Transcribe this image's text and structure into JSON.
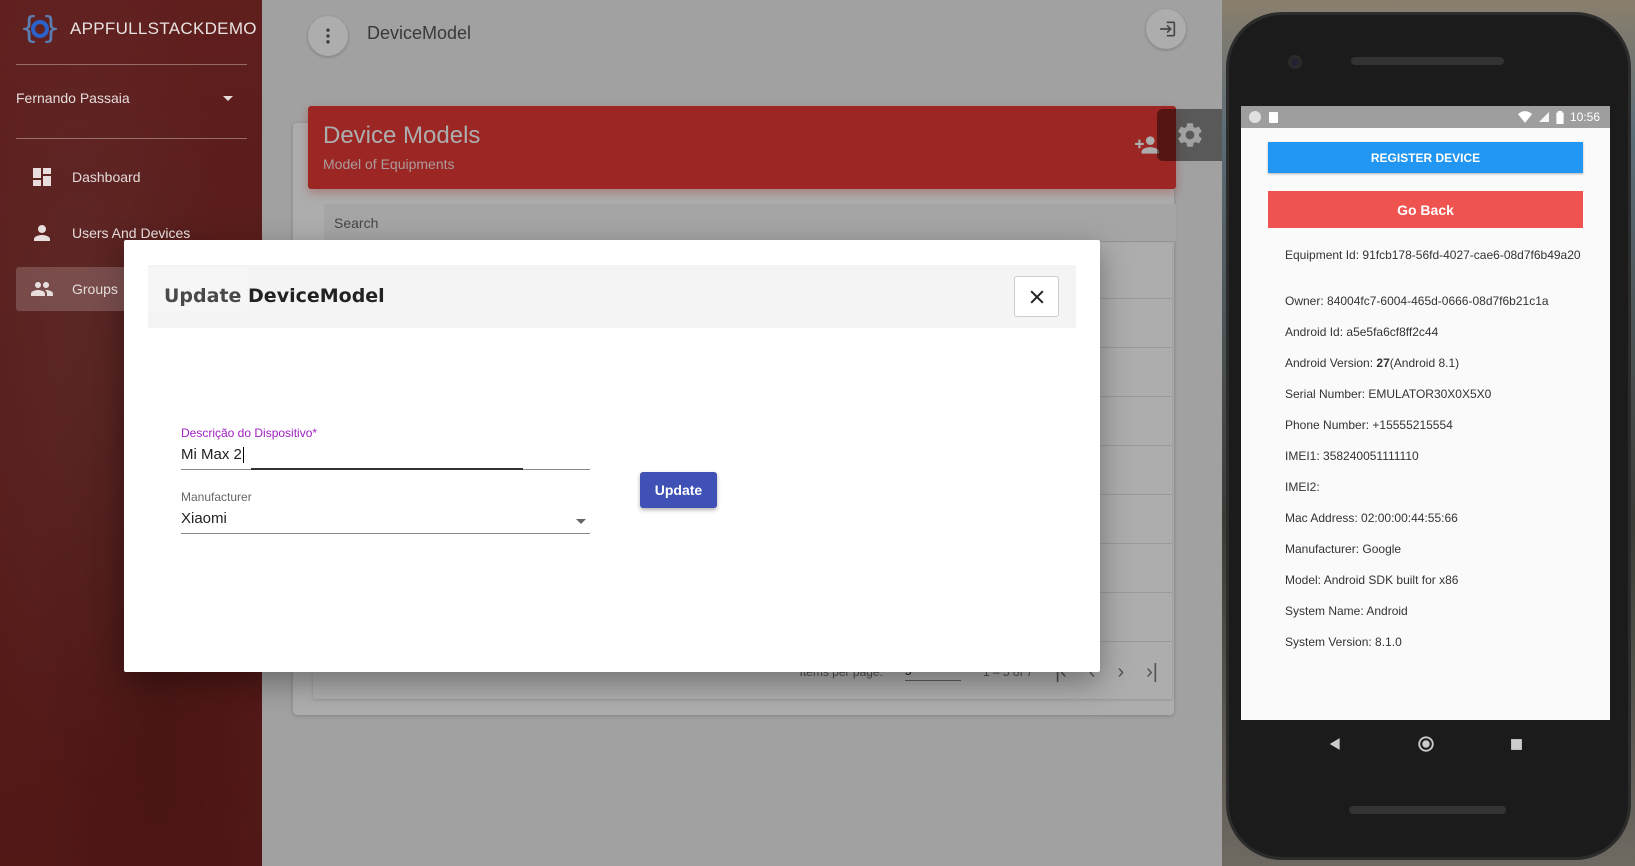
{
  "app": {
    "logo_text": "APPFULLSTACKDEMO"
  },
  "sidebar": {
    "user_name": "Fernando Passaia",
    "items": [
      {
        "label": "Dashboard",
        "icon": "dashboard-icon"
      },
      {
        "label": "Users And Devices",
        "icon": "person-icon"
      },
      {
        "label": "Groups",
        "icon": "group-icon",
        "active": true
      }
    ]
  },
  "header": {
    "title": "DeviceModel"
  },
  "card": {
    "title": "Device Models",
    "subtitle": "Model of Equipments",
    "search_placeholder": "Search"
  },
  "paginator": {
    "items_per_page_label": "Items per page:",
    "page_size": "5",
    "range": "1 – 5 of 7"
  },
  "modal": {
    "title": "Update DeviceModel",
    "description_label": "Descrição do Dispositivo*",
    "description_value": "Mi Max 2",
    "manufacturer_label": "Manufacturer",
    "manufacturer_value": "Xiaomi",
    "update_label": "Update"
  },
  "phone": {
    "time": "10:56",
    "register_label": "REGISTER DEVICE",
    "back_label": "Go Back",
    "info": [
      {
        "label": "Equipment Id:",
        "value": "91fcb178-56fd-4027-cae6-08d7f6b49a20"
      },
      {
        "label": "Owner:",
        "value": "84004fc7-6004-465d-0666-08d7f6b21c1a"
      },
      {
        "label": "Android Id:",
        "value": "a5e5fa6cf8ff2c44"
      },
      {
        "label": "Android Version:",
        "value_bold": "27",
        "value": "(Android 8.1)"
      },
      {
        "label": "Serial Number:",
        "value": "EMULATOR30X0X5X0"
      },
      {
        "label": "Phone Number:",
        "value": "+15555215554"
      },
      {
        "label": "IMEI1:",
        "value": "358240051111110"
      },
      {
        "label": "IMEI2:",
        "value": ""
      },
      {
        "label": "Mac Address:",
        "value": "02:00:00:44:55:66"
      },
      {
        "label": "Manufacturer:",
        "value": "Google"
      },
      {
        "label": "Model:",
        "value": "Android SDK built for x86"
      },
      {
        "label": "System Name:",
        "value": "Android"
      },
      {
        "label": "System Version:",
        "value": "8.1.0"
      }
    ]
  },
  "colors": {
    "brand_red": "#e53935",
    "primary_blue": "#3f51b5",
    "register_blue": "#2196f3",
    "back_red": "#ef5350",
    "focus_purple": "#a020c0"
  }
}
